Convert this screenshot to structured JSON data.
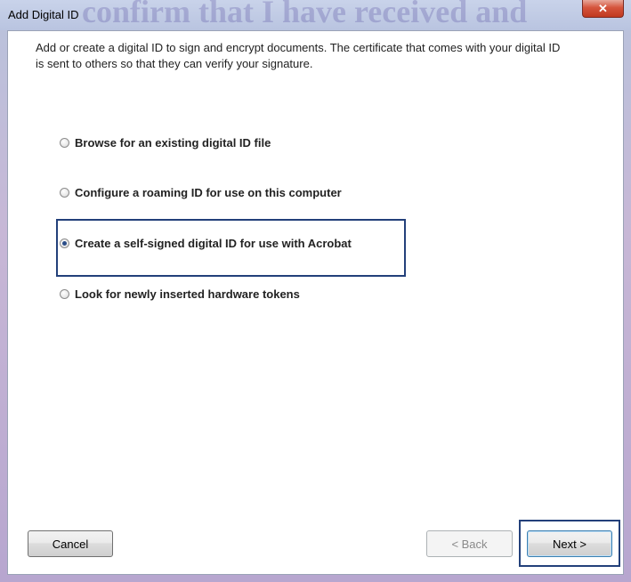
{
  "window": {
    "title": "Add Digital ID",
    "background_text": "confirm that I have received and"
  },
  "dialog": {
    "description": "Add or create a digital ID to sign and encrypt documents. The certificate that comes with your digital ID is sent to others so that they can verify your signature.",
    "options": [
      {
        "label": "Browse for an existing digital ID file",
        "checked": false
      },
      {
        "label": "Configure a roaming ID for use on this computer",
        "checked": false
      },
      {
        "label": "Create a self-signed digital ID for use with Acrobat",
        "checked": true
      },
      {
        "label": "Look for newly inserted hardware tokens",
        "checked": false
      }
    ]
  },
  "buttons": {
    "cancel": "Cancel",
    "back": "< Back",
    "next": "Next >",
    "back_enabled": false
  },
  "colors": {
    "highlight_border": "#23407a"
  }
}
